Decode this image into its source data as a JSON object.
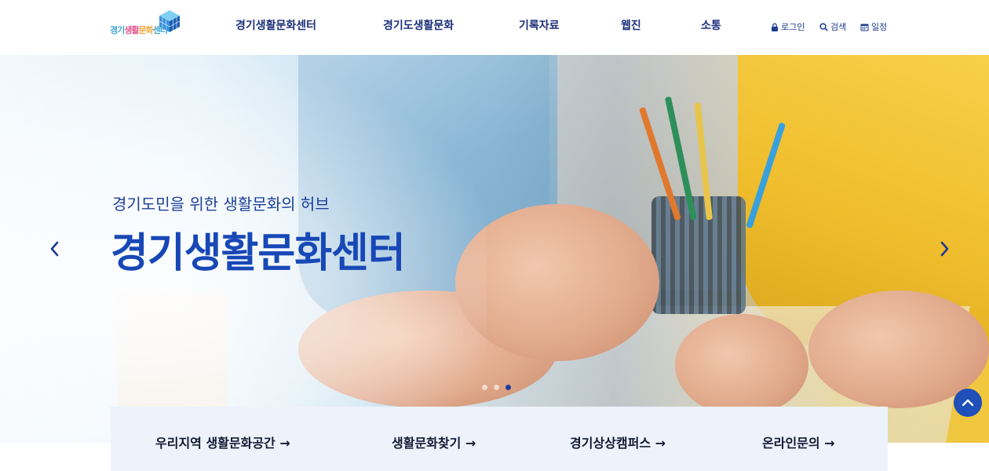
{
  "logo": {
    "text_parts": [
      "경기",
      "생활",
      "문화",
      "센터"
    ]
  },
  "nav": {
    "items": [
      {
        "label": "경기생활문화센터"
      },
      {
        "label": "경기도생활문화"
      },
      {
        "label": "기록자료"
      },
      {
        "label": "웹진"
      },
      {
        "label": "소통"
      }
    ]
  },
  "utility": {
    "login": {
      "label": "로그인",
      "icon": "lock-icon"
    },
    "search": {
      "label": "검색",
      "icon": "search-icon"
    },
    "schedule": {
      "label": "일정",
      "icon": "calendar-icon"
    }
  },
  "hero": {
    "subtitle": "경기도민을 위한 생활문화의 허브",
    "title": "경기생활문화센터",
    "prev_icon": "chevron-left-icon",
    "next_icon": "chevron-right-icon",
    "slide_count": 3,
    "active_slide": 3
  },
  "quick_links": [
    {
      "label": "우리지역 생활문화공간 →"
    },
    {
      "label": "생활문화찾기 →"
    },
    {
      "label": "경기상상캠퍼스 →"
    },
    {
      "label": "온라인문의 →"
    }
  ],
  "scroll_top_icon": "chevron-up-icon",
  "colors": {
    "primary": "#1848b6",
    "nav_text": "#1c2f7a",
    "quick_bg": "#edf2fb",
    "top_button": "#1f4fb8"
  }
}
